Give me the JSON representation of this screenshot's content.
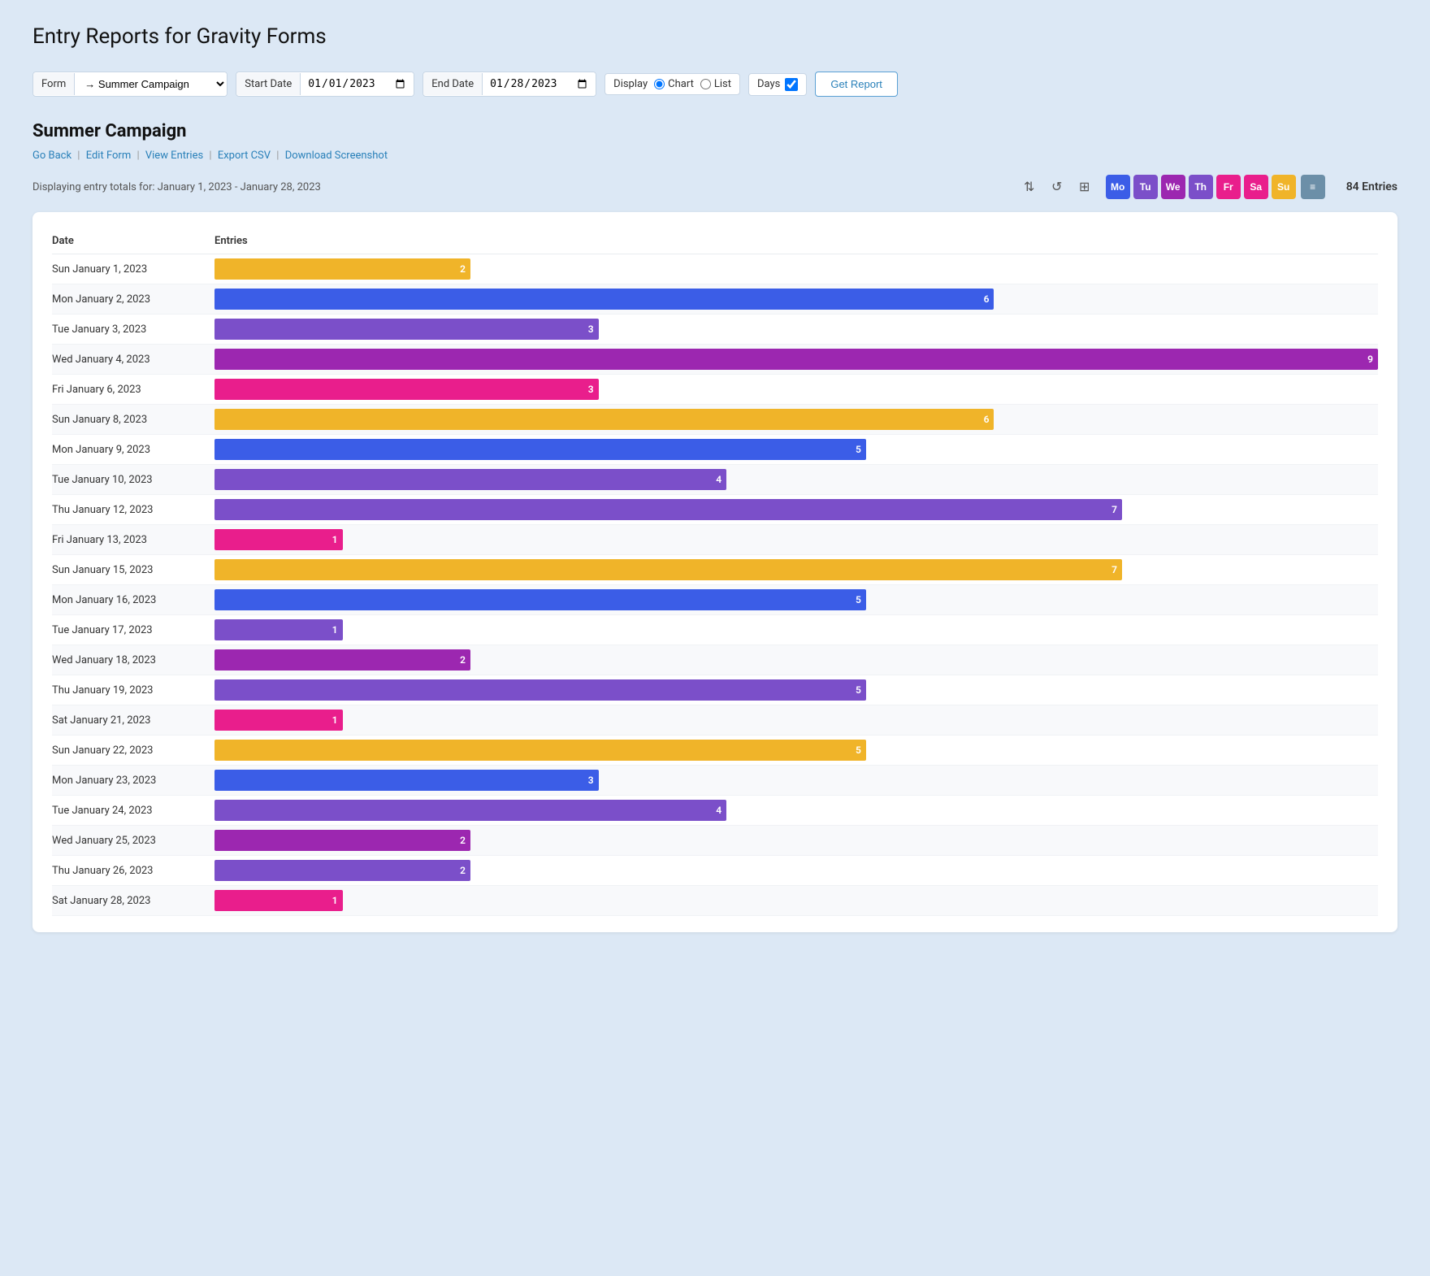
{
  "page": {
    "title": "Entry Reports for Gravity Forms"
  },
  "toolbar": {
    "form_label": "Form",
    "form_value": "→ Summer Campaign",
    "start_date_label": "Start Date",
    "start_date_value": "2023-01-01",
    "end_date_label": "End Date",
    "end_date_value": "2023-01-28",
    "display_label": "Display",
    "display_chart": "Chart",
    "display_list": "List",
    "days_label": "Days",
    "days_checked": true,
    "get_report_label": "Get Report"
  },
  "campaign": {
    "title": "Summer Campaign",
    "links": {
      "go_back": "Go Back",
      "edit_form": "Edit Form",
      "view_entries": "View Entries",
      "export_csv": "Export CSV",
      "download_screenshot": "Download Screenshot"
    },
    "display_text": "Displaying entry totals for: January 1, 2023 - January 28, 2023",
    "entries_count": "84 Entries"
  },
  "day_buttons": [
    {
      "label": "Mo",
      "color": "#3b5de7"
    },
    {
      "label": "Tu",
      "color": "#7b4fc9"
    },
    {
      "label": "We",
      "color": "#9c27b0"
    },
    {
      "label": "Th",
      "color": "#7b4fc9"
    },
    {
      "label": "Fr",
      "color": "#e91e8c"
    },
    {
      "label": "Sa",
      "color": "#e91e8c"
    },
    {
      "label": "Su",
      "color": "#f0b429"
    }
  ],
  "columns": {
    "date": "Date",
    "entries": "Entries"
  },
  "chart_data": [
    {
      "date": "Sun January 1, 2023",
      "value": 2,
      "color": "#f0b429",
      "max_pct": 22
    },
    {
      "date": "Mon January 2, 2023",
      "value": 6,
      "color": "#3b5de7",
      "max_pct": 67
    },
    {
      "date": "Tue January 3, 2023",
      "value": 3,
      "color": "#7b4fc9",
      "max_pct": 33
    },
    {
      "date": "Wed January 4, 2023",
      "value": 9,
      "color": "#9c27b0",
      "max_pct": 100
    },
    {
      "date": "Fri January 6, 2023",
      "value": 3,
      "color": "#e91e8c",
      "max_pct": 33
    },
    {
      "date": "Sun January 8, 2023",
      "value": 6,
      "color": "#f0b429",
      "max_pct": 67
    },
    {
      "date": "Mon January 9, 2023",
      "value": 5,
      "color": "#3b5de7",
      "max_pct": 56
    },
    {
      "date": "Tue January 10, 2023",
      "value": 4,
      "color": "#7b4fc9",
      "max_pct": 44
    },
    {
      "date": "Thu January 12, 2023",
      "value": 7,
      "color": "#7b4fc9",
      "max_pct": 78
    },
    {
      "date": "Fri January 13, 2023",
      "value": 1,
      "color": "#e91e8c",
      "max_pct": 11
    },
    {
      "date": "Sun January 15, 2023",
      "value": 7,
      "color": "#f0b429",
      "max_pct": 78
    },
    {
      "date": "Mon January 16, 2023",
      "value": 5,
      "color": "#3b5de7",
      "max_pct": 56
    },
    {
      "date": "Tue January 17, 2023",
      "value": 1,
      "color": "#7b4fc9",
      "max_pct": 11
    },
    {
      "date": "Wed January 18, 2023",
      "value": 2,
      "color": "#9c27b0",
      "max_pct": 22
    },
    {
      "date": "Thu January 19, 2023",
      "value": 5,
      "color": "#7b4fc9",
      "max_pct": 56
    },
    {
      "date": "Sat January 21, 2023",
      "value": 1,
      "color": "#e91e8c",
      "max_pct": 11
    },
    {
      "date": "Sun January 22, 2023",
      "value": 5,
      "color": "#f0b429",
      "max_pct": 56
    },
    {
      "date": "Mon January 23, 2023",
      "value": 3,
      "color": "#3b5de7",
      "max_pct": 33
    },
    {
      "date": "Tue January 24, 2023",
      "value": 4,
      "color": "#7b4fc9",
      "max_pct": 44
    },
    {
      "date": "Wed January 25, 2023",
      "value": 2,
      "color": "#9c27b0",
      "max_pct": 22
    },
    {
      "date": "Thu January 26, 2023",
      "value": 2,
      "color": "#7b4fc9",
      "max_pct": 22
    },
    {
      "date": "Sat January 28, 2023",
      "value": 1,
      "color": "#e91e8c",
      "max_pct": 11
    }
  ]
}
